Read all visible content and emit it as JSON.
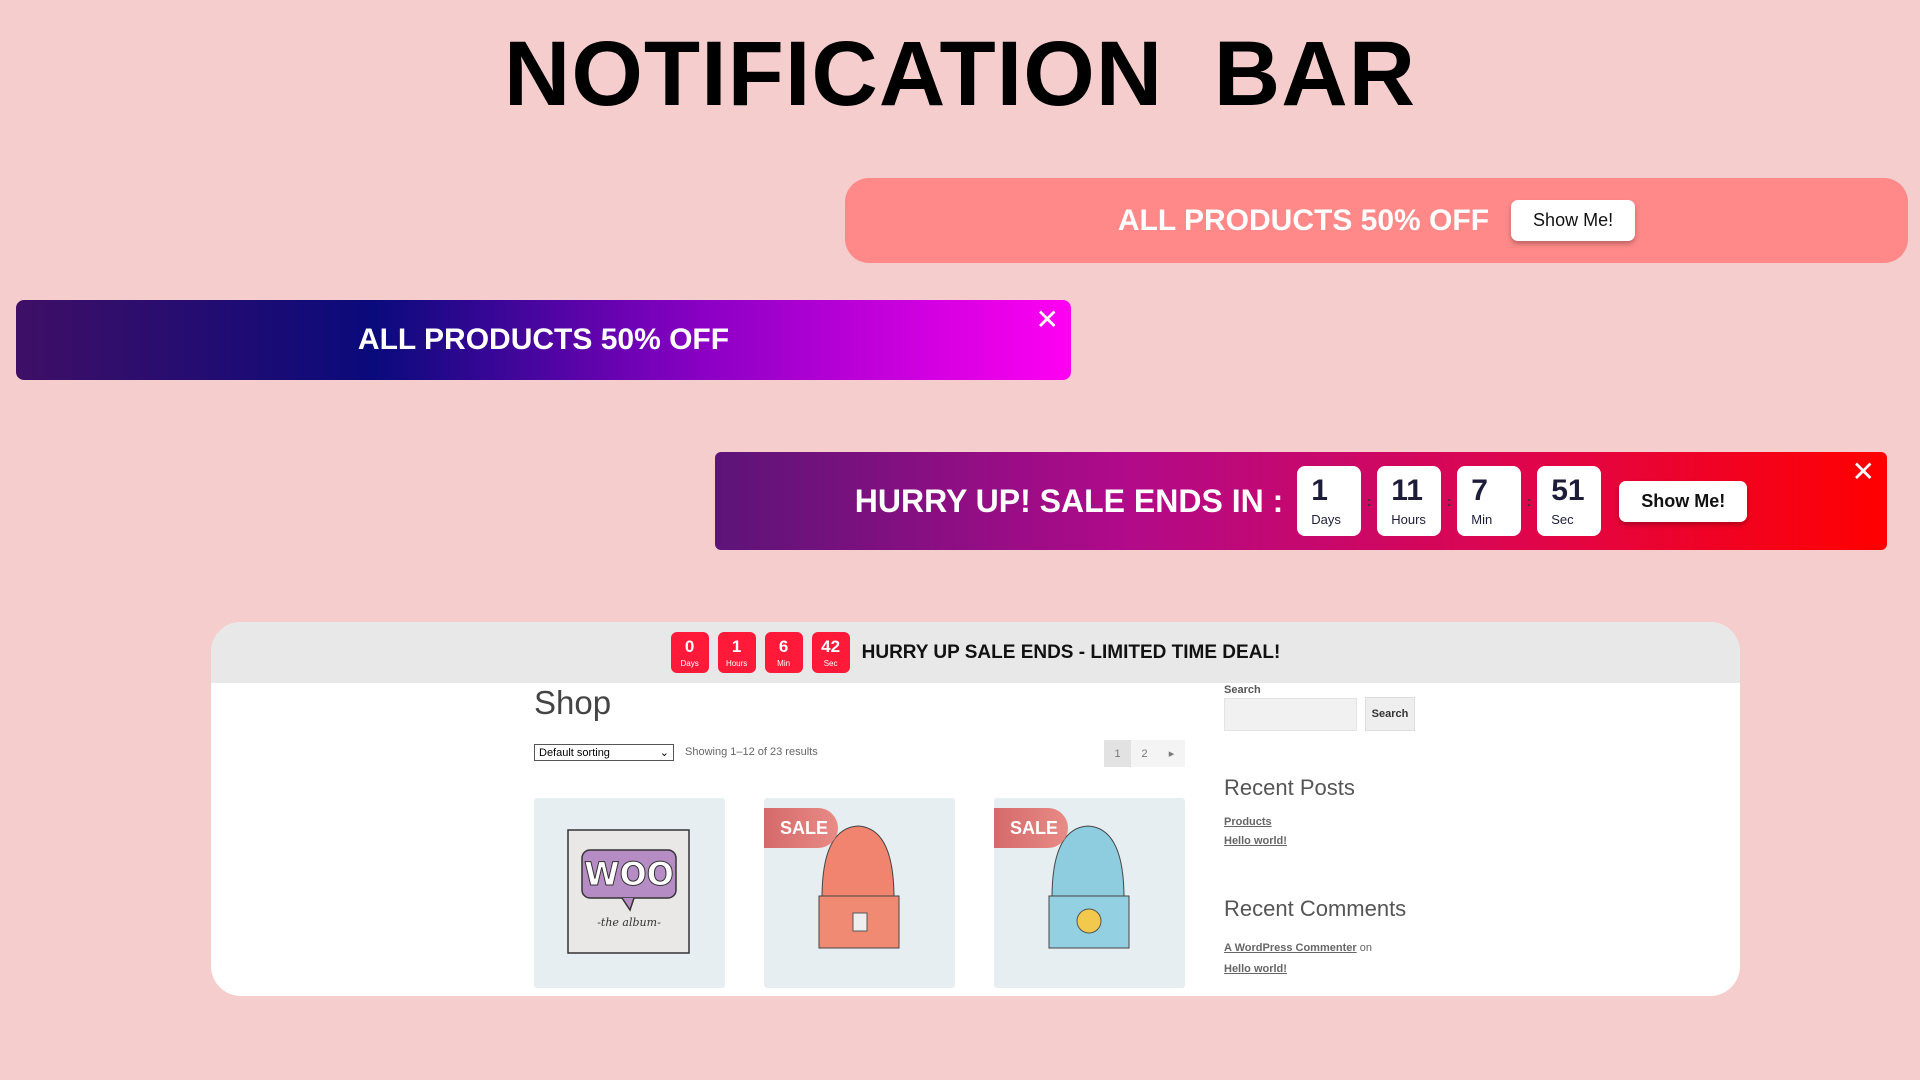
{
  "title": "NOTIFICATION BAR",
  "bar1": {
    "message": "ALL PRODUCTS 50% OFF",
    "button": "Show Me!",
    "bg_color": "#ff8888"
  },
  "bar2": {
    "message": "ALL PRODUCTS 50% OFF",
    "close": "✕"
  },
  "bar3": {
    "message": "HURRY UP! SALE ENDS IN :",
    "countdown": [
      {
        "value": "1",
        "label": "Days"
      },
      {
        "value": "11",
        "label": "Hours"
      },
      {
        "value": "7",
        "label": "Min"
      },
      {
        "value": "51",
        "label": "Sec"
      }
    ],
    "separator": ":",
    "button": "Show Me!",
    "close": "✕"
  },
  "shop": {
    "bar": {
      "countdown": [
        {
          "value": "0",
          "label": "Days"
        },
        {
          "value": "1",
          "label": "Hours"
        },
        {
          "value": "6",
          "label": "Min"
        },
        {
          "value": "42",
          "label": "Sec"
        }
      ],
      "message": "HURRY UP SALE ENDS - LIMITED TIME DEAL!",
      "accent": "#ff1a3a"
    },
    "page_title": "Shop",
    "sorting": "Default sorting",
    "results": "Showing 1–12 of 23 results",
    "pages": [
      "1",
      "2",
      "▸"
    ],
    "sale_badge": "SALE",
    "album_text": {
      "logo": "WOO",
      "caption": "-the album-"
    },
    "sidebar": {
      "search_label": "Search",
      "search_button": "Search",
      "recent_posts_title": "Recent Posts",
      "recent_posts": [
        "Products",
        "Hello world!"
      ],
      "recent_comments_title": "Recent Comments",
      "comment": {
        "author": "A WordPress Commenter",
        "on": "on",
        "post": "Hello world!"
      }
    }
  }
}
